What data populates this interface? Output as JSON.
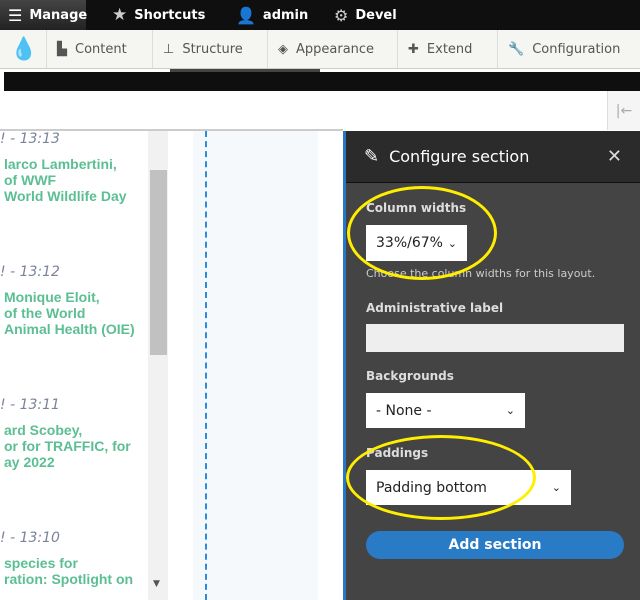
{
  "toolbar": {
    "manage": "Manage",
    "shortcuts": "Shortcuts",
    "user": "admin",
    "devel": "Devel"
  },
  "tray": {
    "items": [
      "Content",
      "Structure",
      "Appearance",
      "Extend",
      "Configuration"
    ]
  },
  "content": {
    "items": [
      {
        "time": "! - 13:13",
        "lines": [
          "larco Lambertini,",
          "of WWF",
          "World Wildlife Day"
        ]
      },
      {
        "time": "! - 13:12",
        "lines": [
          "Monique Eloit,",
          "of the World",
          "Animal Health (OIE)"
        ]
      },
      {
        "time": "! - 13:11",
        "lines": [
          "ard Scobey,",
          "or for TRAFFIC, for",
          "ay 2022"
        ]
      },
      {
        "time": "! - 13:10",
        "lines": [
          "species for",
          "ration: Spotlight on"
        ]
      }
    ]
  },
  "panel": {
    "title": "Configure section",
    "column_widths_label": "Column widths",
    "column_widths_value": "33%/67%",
    "column_widths_help": "Choose the column widths for this layout.",
    "admin_label": "Administrative label",
    "admin_value": "",
    "backgrounds_label": "Backgrounds",
    "backgrounds_value": "- None -",
    "paddings_label": "Paddings",
    "paddings_value": "Padding bottom",
    "submit": "Add section"
  },
  "colors": {
    "accent": "#2777c4",
    "link": "#5bbf93",
    "annotation": "#ffee00"
  }
}
